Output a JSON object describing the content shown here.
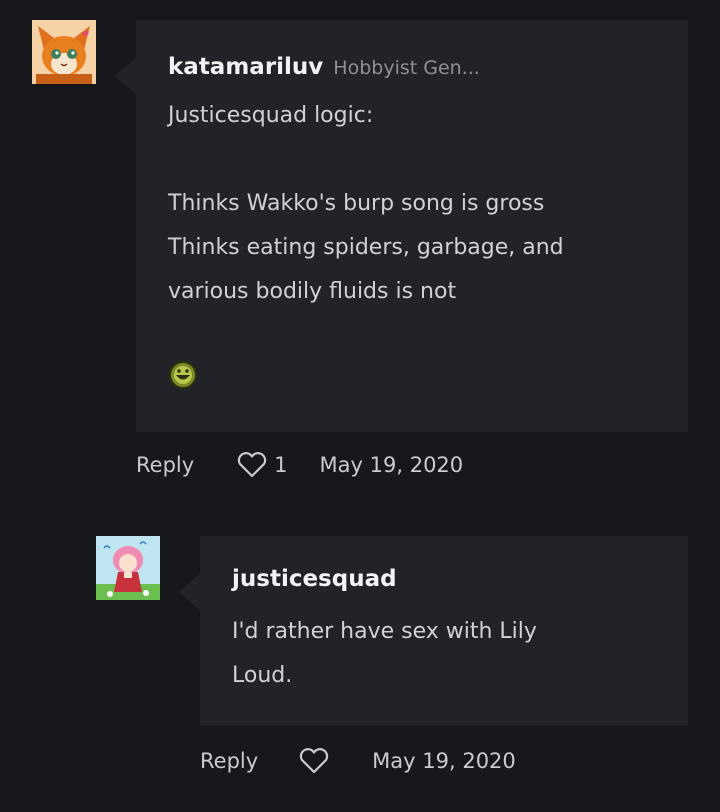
{
  "comments": [
    {
      "username": "katamariluv",
      "role": "Hobbyist Gen...",
      "text": "Justicesquad logic:\n\nThinks Wakko's burp song is gross\nThinks eating spiders, garbage, and\nvarious bodily fluids is not",
      "reply_label": "Reply",
      "likes": "1",
      "date": "May 19, 2020",
      "emoji_icon": "grinning-green-emoticon-icon",
      "avatar_icon": "orange-fox-avatar-icon"
    },
    {
      "username": "justicesquad",
      "text": "I'd rather have sex with Lily\nLoud.",
      "reply_label": "Reply",
      "date": "May 19, 2020",
      "avatar_icon": "pink-haired-girl-avatar-icon"
    }
  ],
  "colors": {
    "background": "#17181c",
    "bubble": "#222328",
    "username": "#f2f3f5",
    "text": "#cfd1d5",
    "muted": "#8d9097"
  }
}
